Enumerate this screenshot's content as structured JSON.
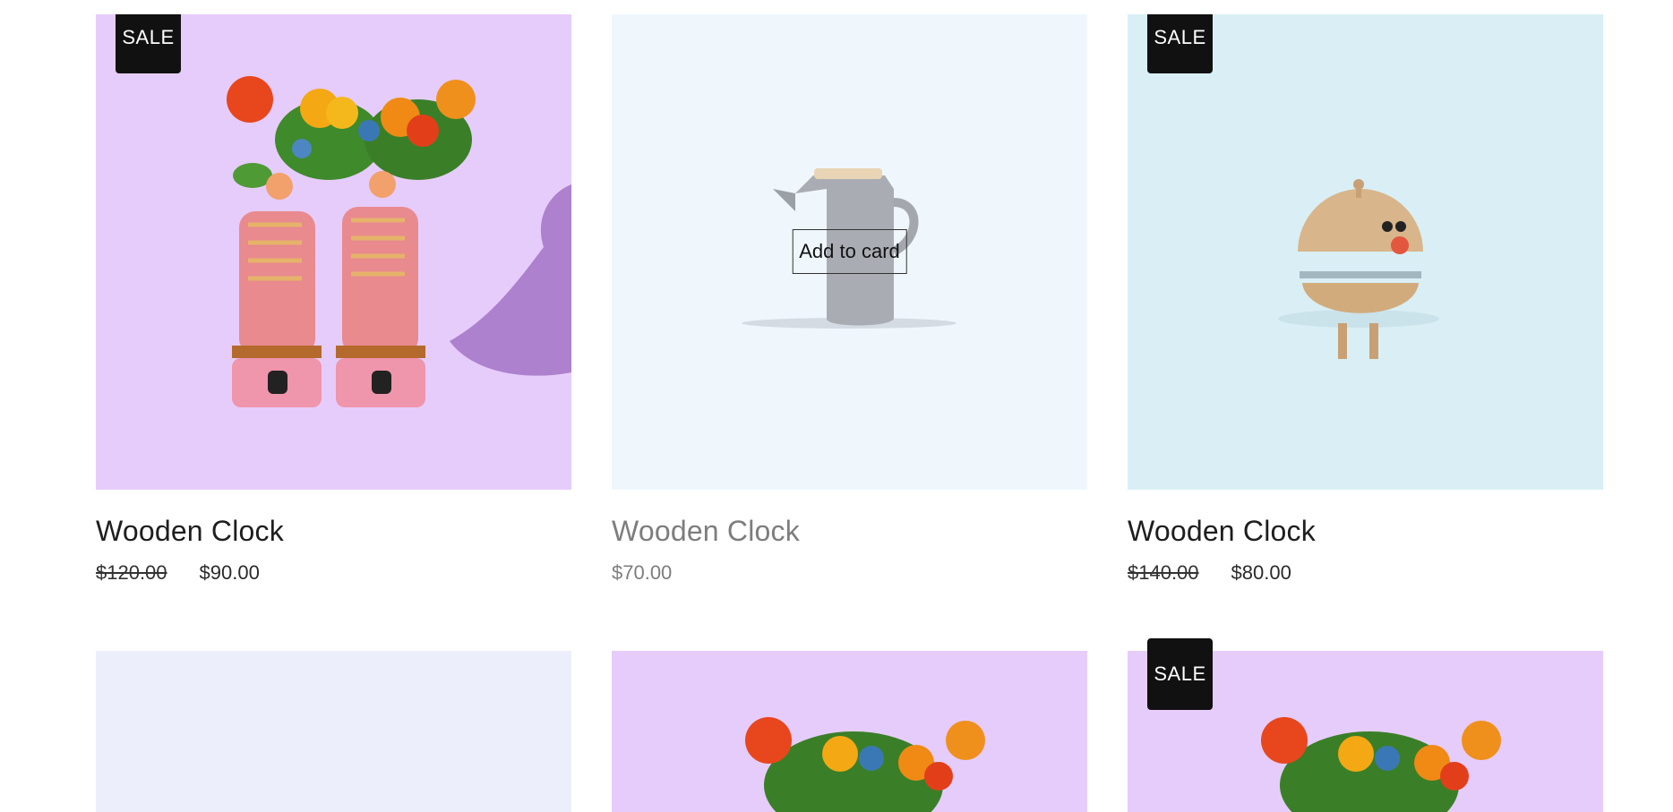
{
  "products": [
    {
      "title": "Wooden Clock",
      "price_old": "$120.00",
      "price": "$90.00",
      "badge": "SALE",
      "bg": "#e6ccfb",
      "image": "roller-skates-flowers"
    },
    {
      "title": "Wooden Clock",
      "price": "$70.00",
      "bg": "#eff7fd",
      "image": "grey-teapot",
      "cta": "Add to card"
    },
    {
      "title": "Wooden Clock",
      "price_old": "$140.00",
      "price": "$80.00",
      "badge": "SALE",
      "bg": "#d9eff5",
      "image": "wooden-ball-figure"
    },
    {
      "bg": "#eceffb",
      "image": "empty"
    },
    {
      "bg": "#e6ccfb",
      "image": "flowers"
    },
    {
      "badge": "SALE",
      "bg": "#e6ccfb",
      "image": "flowers"
    }
  ]
}
